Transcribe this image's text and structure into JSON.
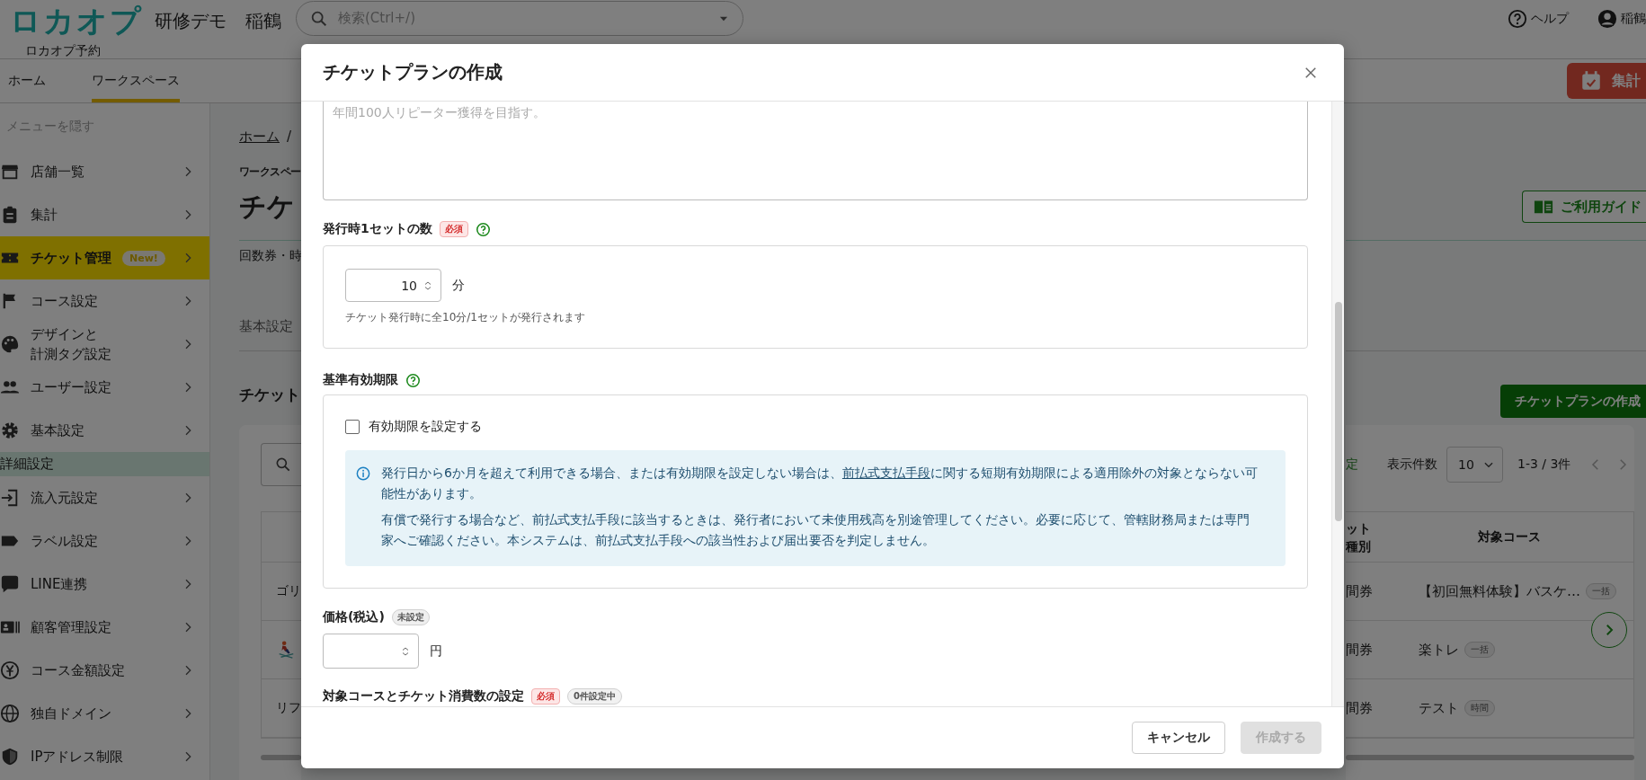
{
  "header": {
    "logo": "ロカオプ",
    "logo_caption": "ロカオプ予約",
    "organization": "研修デモ",
    "store": "稲鶴",
    "search": {
      "placeholder": "検索(Ctrl+/)"
    },
    "help": "ヘルプ",
    "user": "稲鶴"
  },
  "nav": {
    "tabs": [
      {
        "label": "ホーム",
        "selected": false
      },
      {
        "label": "ワークスペース",
        "selected": true
      }
    ],
    "summary_button": "集計"
  },
  "sidebar": {
    "toggle": "メニューを隠す",
    "items": [
      {
        "kind": "item",
        "label": "店舗一覧",
        "selected": false
      },
      {
        "kind": "item",
        "label": "集計",
        "selected": false
      },
      {
        "kind": "item",
        "label": "チケット管理",
        "badge": "New!",
        "selected": true
      },
      {
        "kind": "item",
        "label": "コース設定",
        "selected": false
      },
      {
        "kind": "item",
        "lines": [
          "デザインと",
          "計測タグ設定"
        ],
        "selected": false
      },
      {
        "kind": "item",
        "label": "ユーザー設定",
        "selected": false
      },
      {
        "kind": "item",
        "label": "基本設定",
        "selected": false
      },
      {
        "kind": "section",
        "label": "詳細設定"
      },
      {
        "kind": "item",
        "label": "流入元設定",
        "selected": false
      },
      {
        "kind": "item",
        "label": "ラベル設定",
        "selected": false
      },
      {
        "kind": "item",
        "label": "LINE連携",
        "selected": false
      },
      {
        "kind": "item",
        "label": "顧客管理設定",
        "selected": false
      },
      {
        "kind": "item",
        "label": "コース金額設定",
        "selected": false
      },
      {
        "kind": "item",
        "label": "独自ドメイン",
        "selected": false
      },
      {
        "kind": "item",
        "label": "IPアドレス制限",
        "selected": false
      }
    ]
  },
  "page_left": {
    "breadcrumb": "ホーム",
    "breadcrumb_separator": "/",
    "workspace": "ワークスペー",
    "title": "チケ",
    "description": "回数券・時",
    "tab": "基本設定",
    "section_title": "チケット",
    "rows": [
      {
        "kind": "text",
        "text": "ゴリ"
      },
      {
        "kind": "icon"
      },
      {
        "kind": "text",
        "text": "リフ"
      }
    ]
  },
  "page_right": {
    "guide_button": "ご利用ガイド",
    "create_button": "チケットプランの作成",
    "filter_link": "定",
    "page_size_label": "表示件数",
    "page_size": "10",
    "range": "1-3 / 3件",
    "columns": [
      "ット種別",
      "対象コース"
    ],
    "rows": [
      {
        "type": "間券",
        "course": "【初回無料体験】バスケ…",
        "tag": "一括"
      },
      {
        "type": "間券",
        "course": "楽トレ",
        "tag": "一括"
      },
      {
        "type": "間券",
        "course": "テスト",
        "tag": "時間"
      }
    ]
  },
  "modal": {
    "title": "チケットプランの作成",
    "memo": {
      "placeholder": "年間100人リピーター獲得を目指す。"
    },
    "sections": [
      {
        "kind": "number",
        "label": "発行時1セットの数",
        "badge": {
          "kind": "required",
          "text": "必須"
        },
        "help": true,
        "value": "10",
        "unit": "分",
        "hint": "チケット発行時に全10分/1セットが発行されます"
      },
      {
        "kind": "expiry",
        "label": "基準有効期限",
        "help": true,
        "checkbox": {
          "label": "有効期限を設定する",
          "checked": false
        },
        "alert": {
          "before": "発行日から6か月を超えて利用できる場合、または有効期限を設定しない場合は、",
          "link": "前払式支払手段",
          "after": "に関する短期有効期限による適用除外の対象とならない可能性があります。",
          "note": "有償で発行する場合など、前払式支払手段に該当するときは、発行者において未使用残高を別途管理してください。必要に応じて、管轄財務局または専門家へご確認ください。本システムは、前払式支払手段への該当性および届出要否を判定しません。"
        }
      },
      {
        "kind": "price",
        "label": "価格(税込)",
        "badge": {
          "kind": "unset",
          "text": "未設定"
        },
        "help": false,
        "unit": "円"
      },
      {
        "kind": "heading",
        "label": "対象コースとチケット消費数の設定",
        "badge": {
          "kind": "required",
          "text": "必須"
        },
        "help": false,
        "count": "0件設定中"
      }
    ],
    "footer": {
      "cancel": "キャンセル",
      "submit": {
        "label": "作成する",
        "disabled": true
      }
    }
  }
}
